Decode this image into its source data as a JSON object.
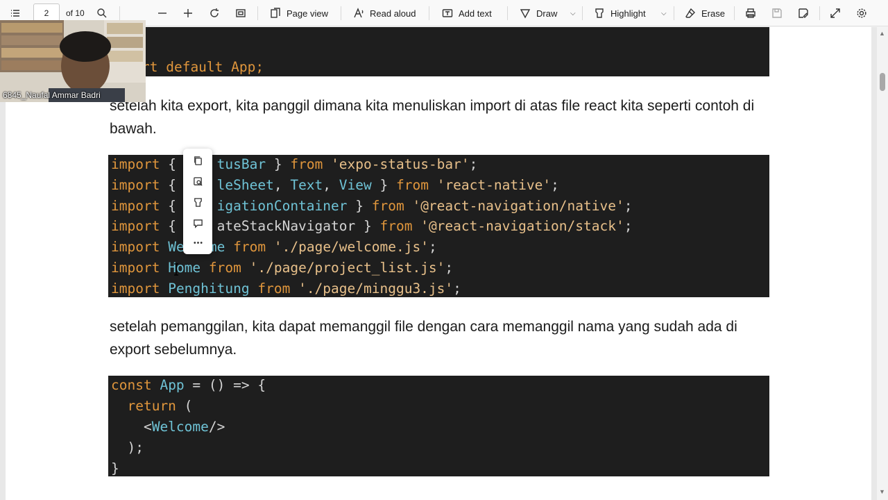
{
  "toolbar": {
    "page_number": "2",
    "page_total": "of 10",
    "page_view": "Page view",
    "read_aloud": "Read aloud",
    "add_text": "Add text",
    "draw": "Draw",
    "highlight": "Highlight",
    "erase": "Erase"
  },
  "webcam": {
    "participant_name": "6845_Naufal Ammar Badri"
  },
  "document": {
    "code_top": {
      "line": "rt default App;"
    },
    "para1": "setelah kita export, kita panggil dimana kita menuliskan import di atas file react kita seperti contoh di bawah.",
    "code_imports": [
      [
        {
          "c": "kw",
          "t": "import"
        },
        {
          "c": "pl",
          "t": " { "
        },
        {
          "c": "pl",
          "t": "    "
        },
        {
          "c": "tp",
          "t": "tusBar"
        },
        {
          "c": "pl",
          "t": " } "
        },
        {
          "c": "kw",
          "t": "from"
        },
        {
          "c": "pl",
          "t": " "
        },
        {
          "c": "st",
          "t": "'expo-status-bar'"
        },
        {
          "c": "pl",
          "t": ";"
        }
      ],
      [
        {
          "c": "kw",
          "t": "import"
        },
        {
          "c": "pl",
          "t": " { "
        },
        {
          "c": "pl",
          "t": "    "
        },
        {
          "c": "tp",
          "t": "leSheet"
        },
        {
          "c": "pl",
          "t": ", "
        },
        {
          "c": "tp",
          "t": "Text"
        },
        {
          "c": "pl",
          "t": ", "
        },
        {
          "c": "tp",
          "t": "View"
        },
        {
          "c": "pl",
          "t": " } "
        },
        {
          "c": "kw",
          "t": "from"
        },
        {
          "c": "pl",
          "t": " "
        },
        {
          "c": "st",
          "t": "'react-native'"
        },
        {
          "c": "pl",
          "t": ";"
        }
      ],
      [
        {
          "c": "kw",
          "t": "import"
        },
        {
          "c": "pl",
          "t": " { "
        },
        {
          "c": "pl",
          "t": "    "
        },
        {
          "c": "tp",
          "t": "igationContainer"
        },
        {
          "c": "pl",
          "t": " } "
        },
        {
          "c": "kw",
          "t": "from"
        },
        {
          "c": "pl",
          "t": " "
        },
        {
          "c": "st",
          "t": "'@react-navigation/native'"
        },
        {
          "c": "pl",
          "t": ";"
        }
      ],
      [
        {
          "c": "kw",
          "t": "import"
        },
        {
          "c": "pl",
          "t": " { "
        },
        {
          "c": "pl",
          "t": "    "
        },
        {
          "c": "pl",
          "t": "ateStackNavigator"
        },
        {
          "c": "pl",
          "t": " } "
        },
        {
          "c": "kw",
          "t": "from"
        },
        {
          "c": "pl",
          "t": " "
        },
        {
          "c": "st",
          "t": "'@react-navigation/stack'"
        },
        {
          "c": "pl",
          "t": ";"
        }
      ],
      [
        {
          "c": "kw",
          "t": "import"
        },
        {
          "c": "pl",
          "t": " "
        },
        {
          "c": "tp",
          "t": "We"
        },
        {
          "c": "pl",
          "t": "   "
        },
        {
          "c": "tp",
          "t": "me"
        },
        {
          "c": "pl",
          "t": " "
        },
        {
          "c": "kw",
          "t": "from"
        },
        {
          "c": "pl",
          "t": " "
        },
        {
          "c": "st",
          "t": "'./page/welcome.js'"
        },
        {
          "c": "pl",
          "t": ";"
        }
      ],
      [
        {
          "c": "kw",
          "t": "import"
        },
        {
          "c": "pl",
          "t": " "
        },
        {
          "c": "tp",
          "t": "Home"
        },
        {
          "c": "pl",
          "t": " "
        },
        {
          "c": "kw",
          "t": "from"
        },
        {
          "c": "pl",
          "t": " "
        },
        {
          "c": "st",
          "t": "'./page/project_list.js'"
        },
        {
          "c": "pl",
          "t": ";"
        }
      ],
      [
        {
          "c": "kw",
          "t": "import"
        },
        {
          "c": "pl",
          "t": " "
        },
        {
          "c": "tp",
          "t": "Penghitung"
        },
        {
          "c": "pl",
          "t": " "
        },
        {
          "c": "kw",
          "t": "from"
        },
        {
          "c": "pl",
          "t": " "
        },
        {
          "c": "st",
          "t": "'./page/minggu3.js'"
        },
        {
          "c": "pl",
          "t": ";"
        }
      ]
    ],
    "para2": "setelah pemanggilan, kita dapat memanggil file dengan cara memanggil nama yang sudah ada di export sebelumnya.",
    "code_app": [
      [
        {
          "c": "kw",
          "t": "const"
        },
        {
          "c": "pl",
          "t": " "
        },
        {
          "c": "tp",
          "t": "App"
        },
        {
          "c": "pl",
          "t": " = () => {"
        }
      ],
      [
        {
          "c": "pl",
          "t": "  "
        },
        {
          "c": "kw",
          "t": "return"
        },
        {
          "c": "pl",
          "t": " ("
        }
      ],
      [
        {
          "c": "pl",
          "t": "    <"
        },
        {
          "c": "tp",
          "t": "Welcome"
        },
        {
          "c": "pl",
          "t": "/>"
        }
      ],
      [
        {
          "c": "pl",
          "t": "  );"
        }
      ],
      [
        {
          "c": "pl",
          "t": "}"
        }
      ]
    ]
  },
  "colors": {
    "code_bg": "#1e1e1e",
    "keyword": "#e0963c",
    "type": "#6fc3d6",
    "string": "#e8c08a"
  }
}
